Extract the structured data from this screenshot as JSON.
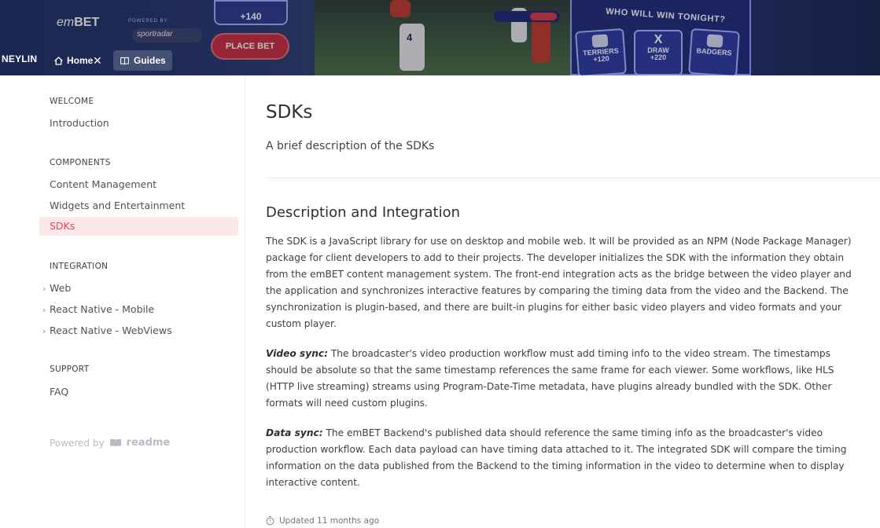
{
  "header": {
    "brand_prefix": "em",
    "brand_suffix": "BET",
    "moneyline": "NEYLIN",
    "sponsor_top": "POWERED BY",
    "sponsor": "sportradar",
    "odds_top": "+140",
    "place_bet": "PLACE BET",
    "poll_title": "WHO WILL WIN TONIGHT?",
    "poll_options": [
      {
        "name": "TERRIERS",
        "odds": "+120"
      },
      {
        "symbol": "X",
        "name": "DRAW",
        "odds": "+220"
      },
      {
        "name": "BADGERS",
        "odds": ""
      }
    ],
    "player_number": "4",
    "nav": {
      "home": "Home",
      "guides": "Guides"
    }
  },
  "sidebar": {
    "sections": [
      {
        "title": "WELCOME",
        "items": [
          {
            "label": "Introduction"
          }
        ]
      },
      {
        "title": "COMPONENTS",
        "items": [
          {
            "label": "Content Management"
          },
          {
            "label": "Widgets and Entertainment"
          },
          {
            "label": "SDKs",
            "active": true
          }
        ]
      },
      {
        "title": "INTEGRATION",
        "items": [
          {
            "label": "Web"
          },
          {
            "label": "React Native - Mobile"
          },
          {
            "label": "React Native - WebViews"
          }
        ]
      },
      {
        "title": "SUPPORT",
        "items": [
          {
            "label": "FAQ"
          }
        ]
      }
    ],
    "powered_by": "Powered by",
    "powered_brand": "readme"
  },
  "main": {
    "title": "SDKs",
    "subtitle": "A brief description of the SDKs",
    "section_heading": "Description and Integration",
    "paragraph1": "The SDK is a JavaScript library for use on desktop and mobile web. It will be provided as an NPM (Node Package Manager) package for client developers to add to their projects. The developer initializes the SDK with the information they obtain from the emBET content management system. The front-end integration acts as the bridge between the video player and the application and synchronizes interactive features by comparing the timing data from the video and the Backend. The synchronization is plugin-based, and there are built-in plugins for either basic video players and video formats and your custom player.",
    "video_sync_label": "Video sync:",
    "video_sync_text": " The broadcaster's video production workflow must add timing info to the video stream. The timestamps should be absolute so that the same timestamp references the same frame for each viewer. Some workflows, like HLS (HTTP live streaming) streams using Program-Date-Time metadata, have plugins already bundled with the SDK. Other formats will need custom plugins.",
    "data_sync_label": "Data sync:",
    "data_sync_text": " The emBET Backend's published data should reference the same timing info as the broadcaster's video production workflow. Each data payload can have timing data attached to it. The integrated SDK will compare the timing information on the data published from the Backend to the timing information in the video to determine when to display interactive content.",
    "updated": "Updated 11 months ago"
  },
  "colors": {
    "accent": "#e0484e",
    "active_bg": "#fce7ea"
  }
}
